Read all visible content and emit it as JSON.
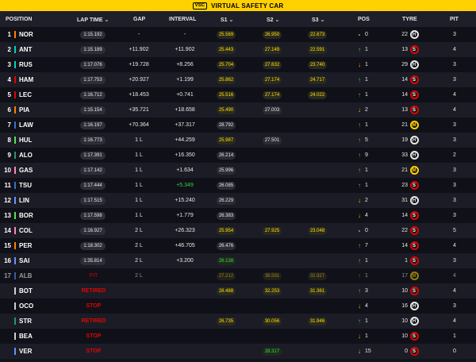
{
  "banner": {
    "badge": "VSC",
    "title": "VIRTUAL SAFETY CAR"
  },
  "header": {
    "position": "POSITION",
    "lap_time": "LAP TIME",
    "gap": "GAP",
    "interval": "INTERVAL",
    "s1": "S1",
    "s2": "S2",
    "s3": "S3",
    "pos": "POS",
    "tyre": "TYRE",
    "pit": "PIT"
  },
  "colors": {
    "banner": "#ffd100",
    "sector_yellow": "#ffe000",
    "sector_green": "#39e039",
    "status_red": "#e10600"
  },
  "rows": [
    {
      "pos": "1",
      "driver": "NOR",
      "team_color": "#ff8000",
      "lap": "1:15.192",
      "gap": "-",
      "interval": "-",
      "s1": "25.569",
      "s1c": "yellow",
      "s2": "26.950",
      "s2c": "yellow",
      "s3": "22.673",
      "s3c": "yellow",
      "arrow": "-",
      "dir": "same",
      "change": "0",
      "laps": "22",
      "tyre": "H",
      "pit": "3"
    },
    {
      "pos": "2",
      "driver": "ANT",
      "team_color": "#00d2be",
      "lap": "1:15.189",
      "gap": "+11.902",
      "interval": "+11.902",
      "s1": "25.443",
      "s1c": "yellow",
      "s2": "27.149",
      "s2c": "yellow",
      "s3": "22.591",
      "s3c": "yellow",
      "arrow": "↑",
      "dir": "up",
      "change": "1",
      "laps": "13",
      "tyre": "S",
      "pit": "4"
    },
    {
      "pos": "3",
      "driver": "RUS",
      "team_color": "#00d2be",
      "lap": "1:17.076",
      "gap": "+19.728",
      "interval": "+8.256",
      "s1": "25.704",
      "s1c": "yellow",
      "s2": "27.632",
      "s2c": "yellow",
      "s3": "23.740",
      "s3c": "yellow",
      "arrow": "↓",
      "dir": "down",
      "change": "1",
      "laps": "29",
      "tyre": "H",
      "pit": "3"
    },
    {
      "pos": "4",
      "driver": "HAM",
      "team_color": "#e10600",
      "lap": "1:17.753",
      "gap": "+20.927",
      "interval": "+1.199",
      "s1": "25.862",
      "s1c": "yellow",
      "s2": "27.174",
      "s2c": "yellow",
      "s3": "24.717",
      "s3c": "yellow",
      "arrow": "↑",
      "dir": "up",
      "change": "1",
      "laps": "14",
      "tyre": "S",
      "pit": "3"
    },
    {
      "pos": "5",
      "driver": "LEC",
      "team_color": "#e10600",
      "lap": "1:16.712",
      "gap": "+18.453",
      "interval": "+0.741",
      "s1": "25.516",
      "s1c": "yellow",
      "s2": "27.174",
      "s2c": "yellow",
      "s3": "24.022",
      "s3c": "yellow",
      "arrow": "↑",
      "dir": "up",
      "change": "1",
      "laps": "14",
      "tyre": "S",
      "pit": "4"
    },
    {
      "pos": "6",
      "driver": "PIA",
      "team_color": "#ff8000",
      "lap": "1:15.154",
      "gap": "+35.721",
      "interval": "+18.658",
      "s1": "25.490",
      "s1c": "yellow",
      "s2": "27.003",
      "s2c": "white",
      "s3": "",
      "s3c": "",
      "arrow": "↓",
      "dir": "down",
      "change": "2",
      "laps": "13",
      "tyre": "S",
      "pit": "4"
    },
    {
      "pos": "7",
      "driver": "LAW",
      "team_color": "#3671c6",
      "lap": "1:16.197",
      "gap": "+70.364",
      "interval": "+37.317",
      "s1": "28.792",
      "s1c": "white",
      "s2": "",
      "s2c": "",
      "s3": "",
      "s3c": "",
      "arrow": "↑",
      "dir": "up",
      "change": "1",
      "laps": "21",
      "tyre": "M",
      "pit": "3"
    },
    {
      "pos": "8",
      "driver": "HUL",
      "team_color": "#52e252",
      "lap": "1:16.773",
      "gap": "1 L",
      "interval": "+44.259",
      "s1": "25.987",
      "s1c": "yellow",
      "s2": "27.501",
      "s2c": "white",
      "s3": "",
      "s3c": "",
      "arrow": "↑",
      "dir": "up",
      "change": "5",
      "laps": "19",
      "tyre": "H",
      "pit": "3"
    },
    {
      "pos": "9",
      "driver": "ALO",
      "team_color": "#229971",
      "lap": "1:17.391",
      "gap": "1 L",
      "interval": "+16.350",
      "s1": "26.214",
      "s1c": "white",
      "s2": "",
      "s2c": "",
      "s3": "",
      "s3c": "",
      "arrow": "↑",
      "dir": "up",
      "change": "9",
      "laps": "33",
      "tyre": "H",
      "pit": "2"
    },
    {
      "pos": "10",
      "driver": "GAS",
      "team_color": "#ff87bc",
      "lap": "1:17.142",
      "gap": "1 L",
      "interval": "+1.634",
      "s1": "25.996",
      "s1c": "white",
      "s2": "",
      "s2c": "",
      "s3": "",
      "s3c": "",
      "arrow": "↑",
      "dir": "up",
      "change": "1",
      "laps": "21",
      "tyre": "M",
      "pit": "3"
    },
    {
      "pos": "11",
      "driver": "TSU",
      "team_color": "#3671c6",
      "lap": "1:17.444",
      "gap": "1 L",
      "interval": "+5.349",
      "intc": "green",
      "s1": "26.085",
      "s1c": "white",
      "s2": "",
      "s2c": "",
      "s3": "",
      "s3c": "",
      "arrow": "↑",
      "dir": "up",
      "change": "1",
      "laps": "23",
      "tyre": "S",
      "pit": "3"
    },
    {
      "pos": "12",
      "driver": "LIN",
      "team_color": "#6692ff",
      "lap": "1:17.515",
      "gap": "1 L",
      "interval": "+15.240",
      "s1": "26.229",
      "s1c": "white",
      "s2": "",
      "s2c": "",
      "s3": "",
      "s3c": "",
      "arrow": "↓",
      "dir": "down",
      "change": "2",
      "laps": "31",
      "tyre": "H",
      "pit": "3"
    },
    {
      "pos": "13",
      "driver": "BOR",
      "team_color": "#52e252",
      "lap": "1:17.598",
      "gap": "1 L",
      "interval": "+1.779",
      "s1": "26.383",
      "s1c": "white",
      "s2": "",
      "s2c": "",
      "s3": "",
      "s3c": "",
      "arrow": "↓",
      "dir": "down",
      "change": "4",
      "laps": "14",
      "tyre": "S",
      "pit": "3"
    },
    {
      "pos": "14",
      "driver": "COL",
      "team_color": "#ff87bc",
      "lap": "1:16.927",
      "gap": "2 L",
      "interval": "+26.323",
      "s1": "25.954",
      "s1c": "yellow",
      "s2": "27.925",
      "s2c": "yellow",
      "s3": "23.048",
      "s3c": "yellow",
      "arrow": "-",
      "dir": "same",
      "change": "0",
      "laps": "22",
      "tyre": "S",
      "pit": "5"
    },
    {
      "pos": "15",
      "driver": "PER",
      "team_color": "#ff8000",
      "lap": "1:18.302",
      "gap": "2 L",
      "interval": "+46.705",
      "s1": "26.476",
      "s1c": "white",
      "s2": "",
      "s2c": "",
      "s3": "",
      "s3c": "",
      "arrow": "↑",
      "dir": "up",
      "change": "7",
      "laps": "14",
      "tyre": "S",
      "pit": "4"
    },
    {
      "pos": "16",
      "driver": "SAI",
      "team_color": "#6692ff",
      "lap": "1:35.814",
      "gap": "2 L",
      "interval": "+3.200",
      "s1": "26.138",
      "s1c": "green",
      "s2": "",
      "s2c": "",
      "s3": "",
      "s3c": "",
      "arrow": "↑",
      "dir": "up",
      "change": "1",
      "laps": "1",
      "tyre": "S",
      "pit": "3"
    },
    {
      "pos": "17",
      "driver": "ALB",
      "team_color": "#6692ff",
      "status": "PIT",
      "gap": "2 L",
      "interval": "",
      "s1": "27.212",
      "s1c": "yellow",
      "s2": "38.591",
      "s2c": "yellow",
      "s3": "32.927",
      "s3c": "yellow",
      "arrow": "↑",
      "dir": "up",
      "change": "1",
      "laps": "17",
      "tyre": "M",
      "pit": "4",
      "dim": true
    },
    {
      "pos": "",
      "driver": "BOT",
      "team_color": "#cfcfcf",
      "status": "RETIRED",
      "gap": "",
      "interval": "",
      "s1": "28.488",
      "s1c": "yellow",
      "s2": "32.253",
      "s2c": "yellow",
      "s3": "31.361",
      "s3c": "yellow",
      "arrow": "↑",
      "dir": "up",
      "change": "3",
      "laps": "10",
      "tyre": "S",
      "pit": "4"
    },
    {
      "pos": "",
      "driver": "OCO",
      "team_color": "#cfcfcf",
      "status": "STOP",
      "gap": "",
      "interval": "",
      "s1": "",
      "s1c": "",
      "s2": "",
      "s2c": "",
      "s3": "",
      "s3c": "",
      "arrow": "↓",
      "dir": "down",
      "change": "4",
      "laps": "16",
      "tyre": "H",
      "pit": "3"
    },
    {
      "pos": "",
      "driver": "STR",
      "team_color": "#229971",
      "status": "RETIRED",
      "gap": "",
      "interval": "",
      "s1": "26.735",
      "s1c": "yellow",
      "s2": "30.056",
      "s2c": "yellow",
      "s3": "31.946",
      "s3c": "yellow",
      "arrow": "↑",
      "dir": "up",
      "change": "1",
      "laps": "10",
      "tyre": "H",
      "pit": "4"
    },
    {
      "pos": "",
      "driver": "BEA",
      "team_color": "#cfcfcf",
      "status": "STOP",
      "gap": "",
      "interval": "",
      "s1": "",
      "s1c": "",
      "s2": "",
      "s2c": "",
      "s3": "",
      "s3c": "",
      "arrow": "↓",
      "dir": "down",
      "change": "1",
      "laps": "10",
      "tyre": "S",
      "pit": "1"
    },
    {
      "pos": "",
      "driver": "VER",
      "team_color": "#6692ff",
      "status": "STOP",
      "gap": "",
      "interval": "",
      "s1": "",
      "s1c": "",
      "s2": "28.317",
      "s2c": "green",
      "s3": "",
      "s3c": "",
      "arrow": "↓",
      "dir": "down",
      "change": "15",
      "laps": "0",
      "tyre": "S",
      "pit": "0"
    }
  ]
}
